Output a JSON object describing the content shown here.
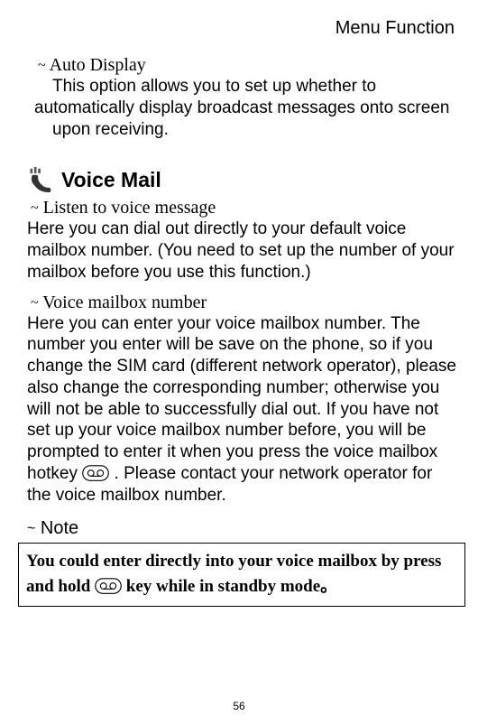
{
  "header": "Menu Function",
  "auto_display": {
    "title": "Auto Display",
    "line1_indent": "This option allows you to set up whether to",
    "line2": "automatically display broadcast messages onto screen",
    "line3_indent": "upon receiving."
  },
  "voice_mail": {
    "title": "Voice Mail",
    "listen": {
      "title": "Listen to voice message",
      "body": "Here you can dial out directly to your default voice mailbox number. (You need to set up the number of your mailbox before you use this function.)"
    },
    "number": {
      "title": "Voice mailbox number",
      "body_before_key": "Here you can enter your voice mailbox number. The number you enter will be save on the phone, so if you change the SIM card (different network operator), please also change the corresponding number; otherwise you will not be able to successfully dial out. If you have not set up your voice mailbox number before, you will be prompted to enter it when you press the voice mailbox hotkey ",
      "body_after_key": ". Please contact your network operator for the voice mailbox number."
    }
  },
  "note": {
    "label": "Note",
    "text_before_key": "You could enter directly into your voice mailbox by press and hold ",
    "text_after_key": " key while in standby mode。"
  },
  "bullet": "~",
  "page_number": "56"
}
